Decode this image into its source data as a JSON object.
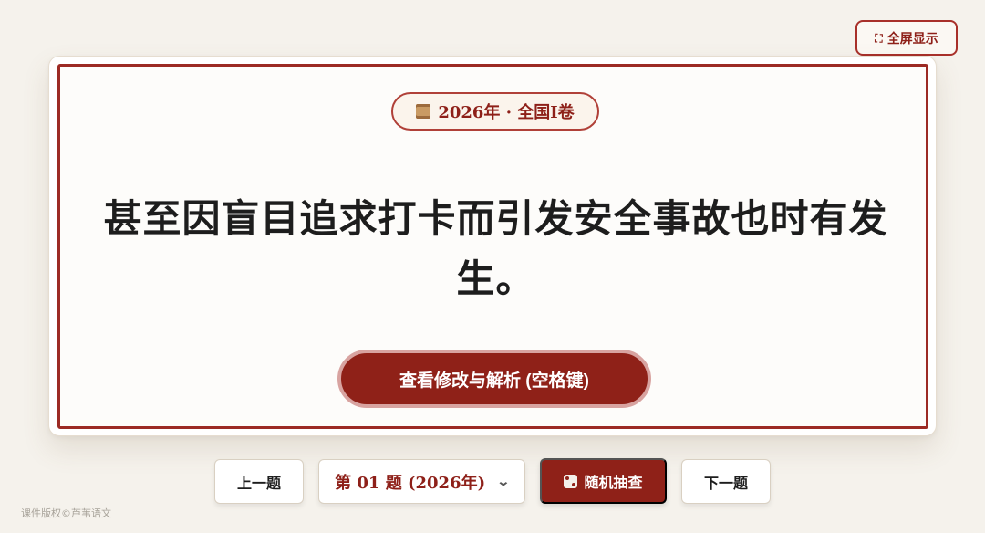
{
  "toolbar": {
    "fullscreen_label": "全屏显示",
    "fullscreen_icon": "fullscreen-icon"
  },
  "card": {
    "badge_label": "2026年 · 全国I卷",
    "badge_icon": "scroll-icon",
    "sentence": "甚至因盲目追求打卡而引发安全事故也时有发生。",
    "reveal_label": "查看修改与解析 (空格键)"
  },
  "nav": {
    "prev_label": "上一题",
    "select_value": "第 01 题 (2026年)",
    "random_label": "随机抽查",
    "random_icon": "dice-icon",
    "next_label": "下一题"
  },
  "footer": {
    "copyright": "课件版权©芦苇语文"
  },
  "colors": {
    "accent": "#8f2118",
    "background": "#f5f2ec"
  }
}
